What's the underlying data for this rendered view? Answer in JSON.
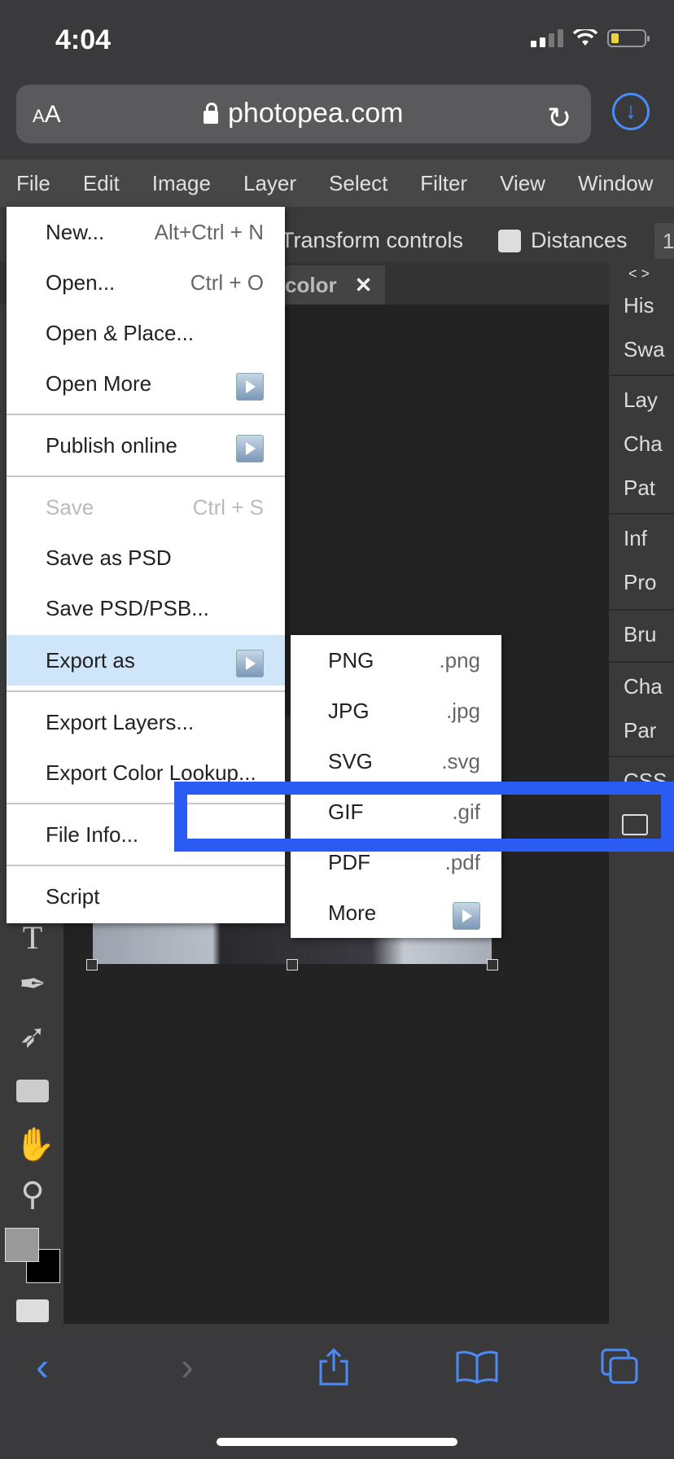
{
  "status_bar": {
    "time": "4:04"
  },
  "browser": {
    "text_size_label_big": "A",
    "text_size_label_small": "A",
    "url": "photopea.com"
  },
  "menubar": {
    "items": [
      "File",
      "Edit",
      "Image",
      "Layer",
      "Select",
      "Filter",
      "View",
      "Window"
    ]
  },
  "options_bar": {
    "transform_label": "Transform controls",
    "distances_label": "Distances",
    "extra": "1"
  },
  "document_tab": {
    "label": "color",
    "close": "✕"
  },
  "right_panel": {
    "items": [
      "His",
      "Swa",
      "Lay",
      "Cha",
      "Pat",
      "Inf",
      "Pro",
      "Bru",
      "Cha",
      "Par",
      "CSS"
    ],
    "arrows": "< >"
  },
  "file_menu": {
    "items": [
      {
        "label": "New...",
        "shortcut": "Alt+Ctrl + N"
      },
      {
        "label": "Open...",
        "shortcut": "Ctrl + O"
      },
      {
        "label": "Open & Place...",
        "shortcut": ""
      },
      {
        "label": "Open More",
        "shortcut": ""
      },
      {
        "label": "Publish online",
        "shortcut": ""
      },
      {
        "label": "Save",
        "shortcut": "Ctrl + S"
      },
      {
        "label": "Save as PSD",
        "shortcut": ""
      },
      {
        "label": "Save PSD/PSB...",
        "shortcut": ""
      },
      {
        "label": "Export as",
        "shortcut": ""
      },
      {
        "label": "Export Layers...",
        "shortcut": ""
      },
      {
        "label": "Export Color Lookup...",
        "shortcut": ""
      },
      {
        "label": "File Info...",
        "shortcut": ""
      },
      {
        "label": "Script",
        "shortcut": ""
      }
    ]
  },
  "export_menu": {
    "items": [
      {
        "label": "PNG",
        "ext": ".png"
      },
      {
        "label": "JPG",
        "ext": ".jpg"
      },
      {
        "label": "SVG",
        "ext": ".svg"
      },
      {
        "label": "GIF",
        "ext": ".gif"
      },
      {
        "label": "PDF",
        "ext": ".pdf"
      },
      {
        "label": "More",
        "ext": ""
      }
    ]
  },
  "colors": {
    "accent": "#4a8cf7",
    "highlight_box": "#2a5cf4",
    "menu_hover": "#cfe6fa",
    "menubar": "#474747"
  },
  "icons": [
    "lock-icon",
    "reload-icon",
    "download-icon",
    "back-icon",
    "forward-icon",
    "share-icon",
    "bookmarks-icon",
    "tabs-icon"
  ]
}
